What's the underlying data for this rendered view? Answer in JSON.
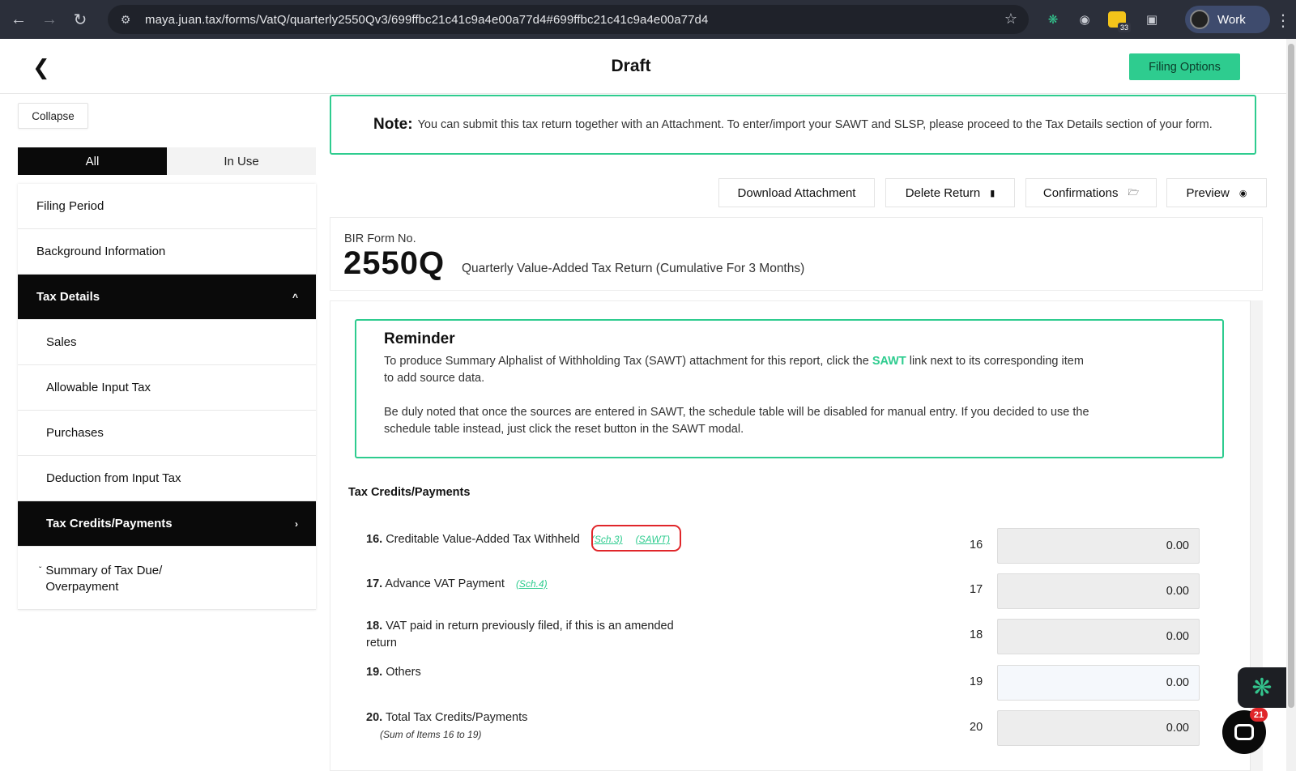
{
  "browser": {
    "url": "maya.juan.tax/forms/VatQ/quarterly2550Qv3/699ffbc21c41c9a4e00a77d4#699ffbc21c41c9a4e00a77d4",
    "extension_badge": "33",
    "profile_name": "Work"
  },
  "header": {
    "title": "Draft",
    "filing_options": "Filing Options"
  },
  "sidebar": {
    "collapse": "Collapse",
    "tabs": {
      "all": "All",
      "in_use": "In Use"
    },
    "items": [
      "Filing Period",
      "Background Information",
      "Tax Details",
      "Sales",
      "Allowable Input Tax",
      "Purchases",
      "Deduction from Input Tax",
      "Tax Credits/Payments",
      "Summary of Tax Due/",
      "Overpayment"
    ]
  },
  "note": {
    "label": "Note:",
    "text": "You can submit this tax return together with an Attachment. To enter/import your SAWT and SLSP, please proceed to the Tax Details section of your form."
  },
  "actions": {
    "download": "Download Attachment",
    "delete": "Delete Return",
    "confirmations": "Confirmations",
    "preview": "Preview"
  },
  "form": {
    "bir_label": "BIR Form No.",
    "number": "2550Q",
    "title": "Quarterly Value-Added Tax Return (Cumulative For 3 Months)"
  },
  "reminder": {
    "title": "Reminder",
    "p1_a": "To produce Summary Alphalist of Withholding Tax (SAWT) attachment for this report, click the ",
    "p1_link": "SAWT",
    "p1_b": " link next to its corresponding item",
    "p1_c": "to add source data.",
    "p2_a": "Be duly noted that once the sources are entered in SAWT, the schedule table will be disabled for manual entry. If you decided to use the",
    "p2_b": "schedule table instead, just click the reset button in the SAWT modal."
  },
  "section": {
    "title": "Tax Credits/Payments",
    "rows": [
      {
        "num": "16.",
        "label": "Creditable Value-Added Tax Withheld",
        "links": [
          "(Sch.3)",
          "(SAWT)"
        ],
        "code": "16",
        "value": "0.00"
      },
      {
        "num": "17.",
        "label": "Advance VAT Payment",
        "links": [
          "(Sch.4)"
        ],
        "code": "17",
        "value": "0.00"
      },
      {
        "num": "18.",
        "label": "VAT paid in return previously filed, if this is an amended",
        "label2": "return",
        "code": "18",
        "value": "0.00"
      },
      {
        "num": "19.",
        "label": "Others",
        "code": "19",
        "value": "0.00"
      },
      {
        "num": "20.",
        "label": "Total Tax Credits/Payments",
        "sub": "(Sum of Items 16 to 19)",
        "code": "20",
        "value": "0.00"
      }
    ]
  },
  "chat": {
    "badge": "21"
  },
  "colors": {
    "accent": "#2ecc8f",
    "highlight": "#e0262a",
    "dark": "#0a0a0a"
  }
}
